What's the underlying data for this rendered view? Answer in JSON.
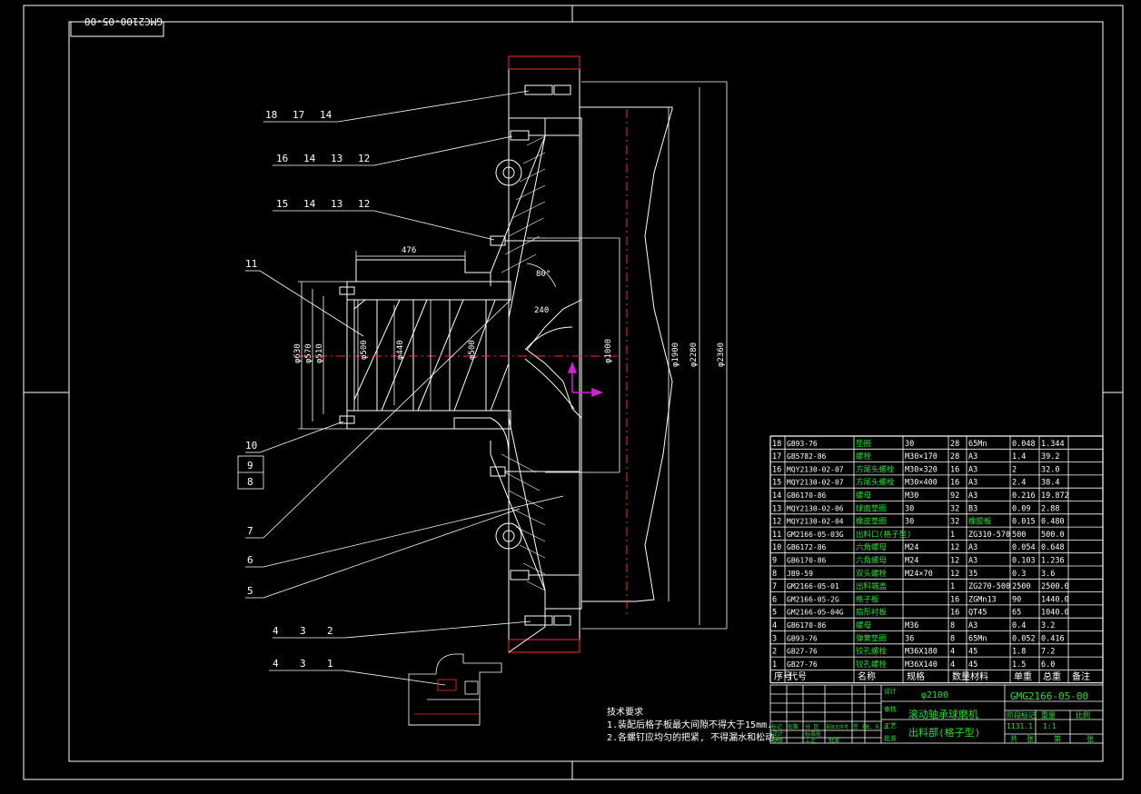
{
  "drawing_code_stamp": "GMC2100-05-00",
  "colors": {
    "background": "#000000",
    "line": "#ffffff",
    "accent_red": "#ff2a2a",
    "axis_magenta": "#d020d0",
    "table_green": "#20e030"
  },
  "leaders": [
    {
      "id": "l1",
      "labels": [
        "18",
        "17",
        "14"
      ]
    },
    {
      "id": "l2",
      "labels": [
        "16",
        "14",
        "13",
        "12"
      ]
    },
    {
      "id": "l3",
      "labels": [
        "15",
        "14",
        "13",
        "12"
      ]
    },
    {
      "id": "l4",
      "labels": [
        "11"
      ]
    },
    {
      "id": "l5",
      "labels": [
        "10"
      ]
    },
    {
      "id": "l6",
      "labels": [
        "9"
      ]
    },
    {
      "id": "l7",
      "labels": [
        "8"
      ]
    },
    {
      "id": "l8",
      "labels": [
        "7"
      ]
    },
    {
      "id": "l9",
      "labels": [
        "6"
      ]
    },
    {
      "id": "l10",
      "labels": [
        "5"
      ]
    },
    {
      "id": "l11",
      "labels": [
        "4",
        "3",
        "2"
      ]
    },
    {
      "id": "l12",
      "labels": [
        "4",
        "3",
        "1"
      ]
    }
  ],
  "dimensions": {
    "len_476": "476",
    "angle_80": "80°",
    "len_240": "240",
    "d630": "φ630",
    "d570": "φ570",
    "d510": "φ510",
    "d500a": "φ500",
    "d440": "φ440",
    "d500b": "φ500",
    "d1000": "φ1000",
    "d1900": "φ1900",
    "d2280": "φ2280",
    "d2360": "φ2360"
  },
  "bom": {
    "headers": [
      "序号",
      "代号",
      "名称",
      "规格",
      "数量",
      "材料",
      "单重",
      "总重",
      "备注"
    ],
    "rows": [
      [
        "18",
        "GB93-76",
        "垫圈",
        "30",
        "28",
        "65Mn",
        "0.048",
        "1.344"
      ],
      [
        "17",
        "GB5782-86",
        "螺栓",
        "M30×170",
        "28",
        "A3",
        "1.4",
        "39.2"
      ],
      [
        "16",
        "MQY2130-02-07",
        "方尾头螺栓",
        "M30×320",
        "16",
        "A3",
        "2",
        "32.0"
      ],
      [
        "15",
        "MQY2130-02-07",
        "方尾头螺栓",
        "M30×400",
        "16",
        "A3",
        "2.4",
        "38.4"
      ],
      [
        "14",
        "GB6170-86",
        "螺母",
        "M30",
        "92",
        "A3",
        "0.216",
        "19.872"
      ],
      [
        "13",
        "MQY2130-02-06",
        "球面垫圈",
        "30",
        "32",
        "B3",
        "0.09",
        "2.88"
      ],
      [
        "12",
        "MQY2130-02-04",
        "橡皮垫圈",
        "30",
        "32",
        "橡胶板",
        "0.015",
        "0.480"
      ],
      [
        "11",
        "GM2166-05-03G",
        "出料口(格子型)",
        "",
        "1",
        "ZG310-570",
        "500",
        "500.0"
      ],
      [
        "10",
        "GB6172-86",
        "六角螺母",
        "M24",
        "12",
        "A3",
        "0.054",
        "0.648"
      ],
      [
        "9",
        "GB6170-86",
        "六角螺母",
        "M24",
        "12",
        "A3",
        "0.103",
        "1.236"
      ],
      [
        "8",
        "JB9-59",
        "双头螺栓",
        "M24×70",
        "12",
        "35",
        "0.3",
        "3.6"
      ],
      [
        "7",
        "GM2166-05-01",
        "出料端盖",
        "",
        "1",
        "ZG270-500",
        "2500",
        "2500.0"
      ],
      [
        "6",
        "GM2166-05-2G",
        "格子板",
        "",
        "16",
        "ZGMn13",
        "90",
        "1440.0"
      ],
      [
        "5",
        "GM2166-05-04G",
        "扇形衬板",
        "",
        "16",
        "QT45",
        "65",
        "1040.0"
      ],
      [
        "4",
        "GB6170-86",
        "螺母",
        "M36",
        "8",
        "A3",
        "0.4",
        "3.2"
      ],
      [
        "3",
        "GB93-76",
        "弹簧垫圈",
        "36",
        "8",
        "65Mn",
        "0.052",
        "0.416"
      ],
      [
        "2",
        "GB27-76",
        "铰孔螺栓",
        "M36X180",
        "4",
        "45",
        "1.8",
        "7.2"
      ],
      [
        "1",
        "GB27-76",
        "铰孔螺栓",
        "M36X140",
        "4",
        "45",
        "1.5",
        "6.0"
      ]
    ]
  },
  "title_block": {
    "project": "φ2100",
    "drawing_no": "GMG2166-05-00",
    "title_main": "滚动轴承球磨机",
    "title_sub": "出料部(格子型)",
    "left_labels": [
      "标记",
      "处数",
      "分 区",
      "更改文件号",
      "签 名",
      "年、月、日"
    ],
    "role_labels": [
      "设计",
      "标准化",
      "审核",
      "工艺",
      "批准"
    ],
    "mid_labels": [
      "阶段标记",
      "重量",
      "比例"
    ],
    "weight": "1131.1",
    "scale": "1:1",
    "sheet_labels": [
      "共",
      "张",
      "第",
      "张"
    ],
    "side_labels": [
      "设计",
      "审核",
      "工艺",
      "批准"
    ]
  },
  "tech_requirements": {
    "title": "技术要求",
    "line1": "1.装配后格子板最大间隙不得大于15mm.",
    "line2": "2.各螺钉应均匀的把紧, 不得漏水和松动."
  }
}
